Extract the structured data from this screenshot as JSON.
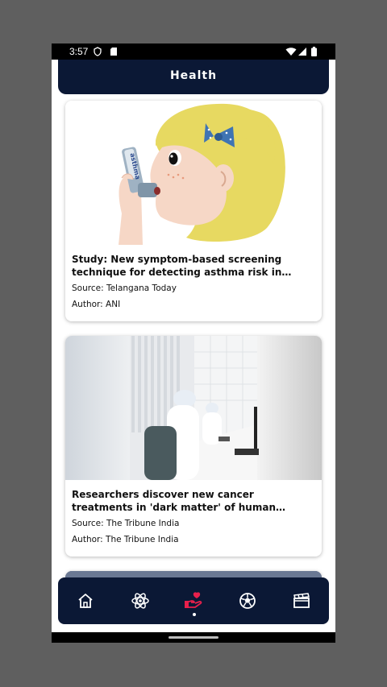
{
  "status_bar": {
    "time": "3:57"
  },
  "header": {
    "title": "Health"
  },
  "articles": [
    {
      "title": "Study: New symptom-based screening technique for detecting asthma risk in children ...",
      "source": "Source: Telangana Today",
      "author": "Author: ANI",
      "inhaler_text": "asthma"
    },
    {
      "title": "Researchers discover new cancer treatments in 'dark matter' of human genome - The Tribune In...",
      "source": "Source: The Tribune India",
      "author": "Author: The Tribune India"
    }
  ],
  "nav": {
    "items": [
      "home-icon",
      "science-icon",
      "health-icon",
      "sports-icon",
      "entertainment-icon"
    ],
    "active": "health-icon",
    "active_color": "#e8204c"
  }
}
